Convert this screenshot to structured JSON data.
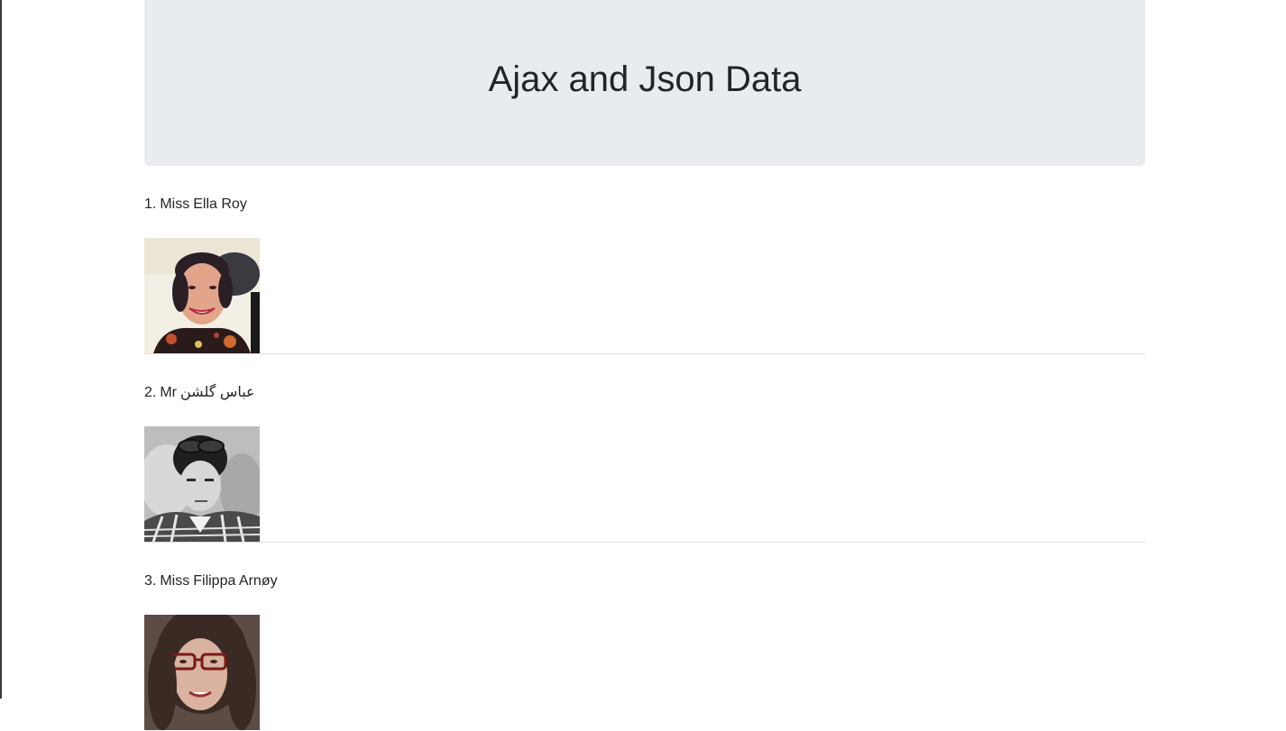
{
  "header": {
    "title": "Ajax and Json Data"
  },
  "users": [
    {
      "index": "1.",
      "title": "Miss",
      "name": "Ella Roy"
    },
    {
      "index": "2.",
      "title": "Mr",
      "name": "عباس گلشن"
    },
    {
      "index": "3.",
      "title": "Miss",
      "name": "Filippa Arnøy"
    }
  ]
}
